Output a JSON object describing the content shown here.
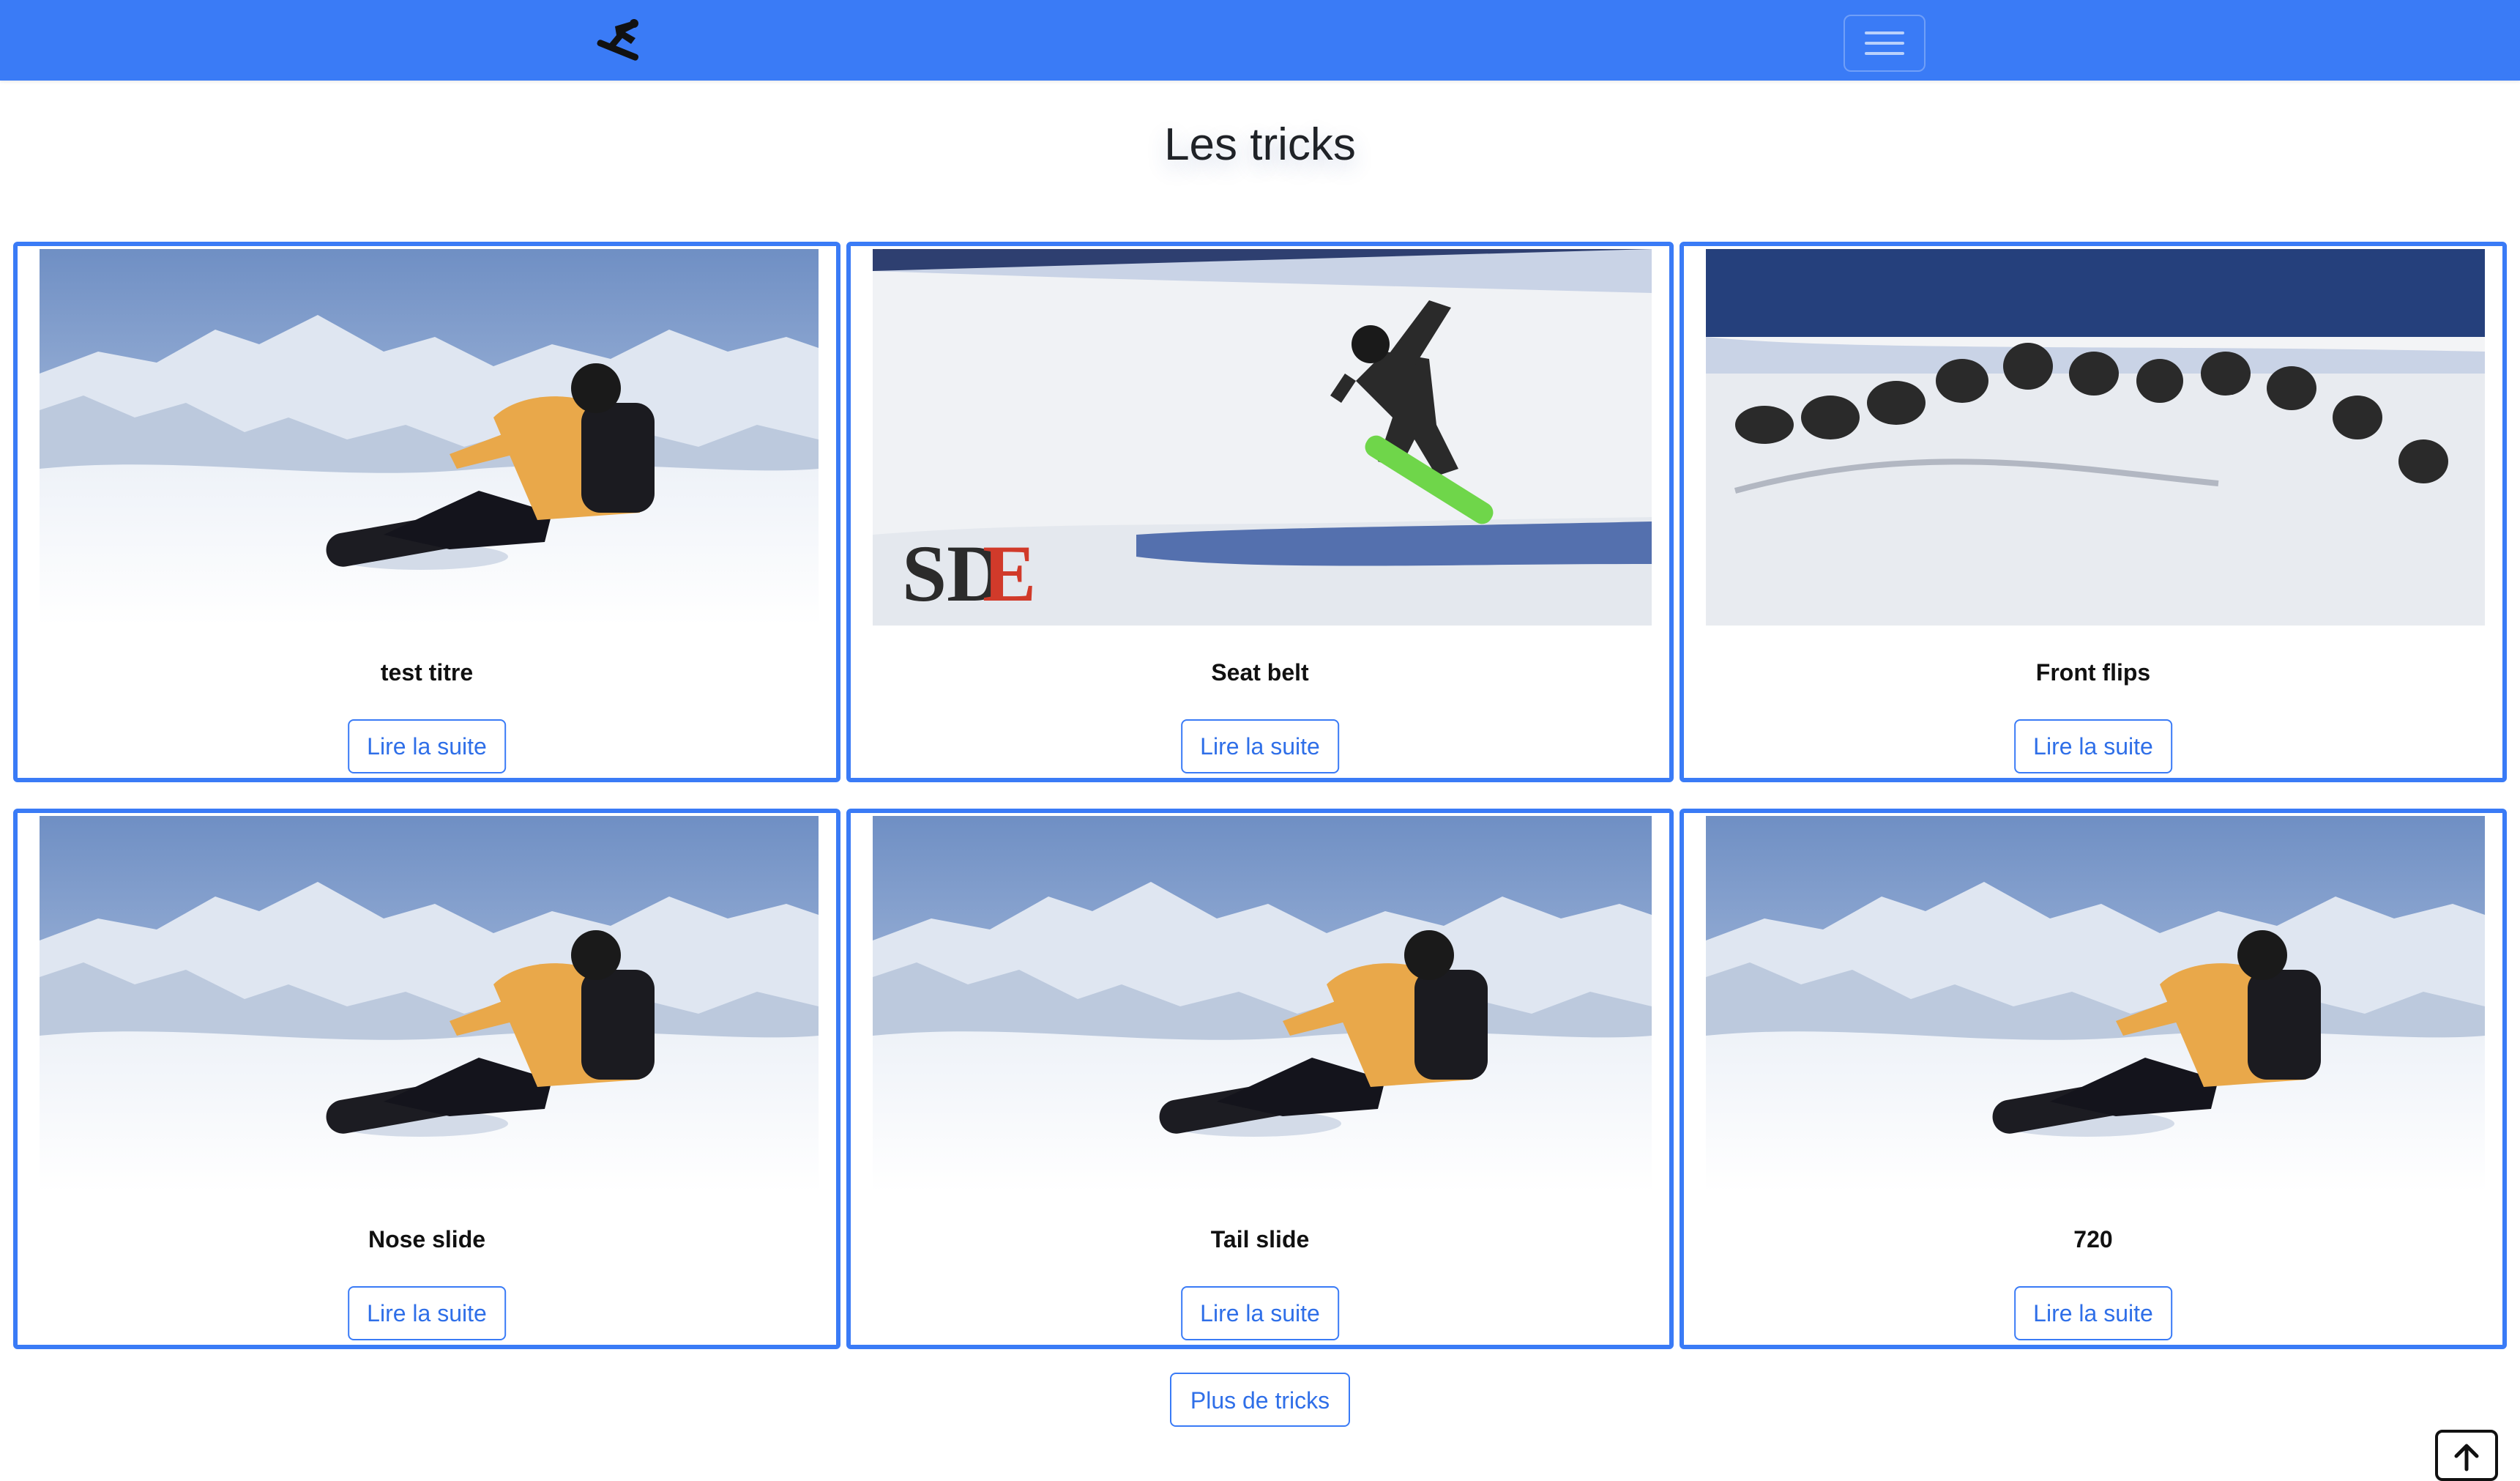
{
  "navbar": {
    "logo_icon": "snowboarder-logo-icon",
    "menu_icon": "hamburger-menu-icon",
    "colors": {
      "background": "#3a7bf6"
    }
  },
  "page": {
    "title": "Les tricks"
  },
  "tricks": [
    {
      "title": "test titre",
      "image": "seated-snowboarder-photo",
      "button": "Lire la suite"
    },
    {
      "title": "Seat belt",
      "image": "jumping-snowboarder-photo",
      "button": "Lire la suite"
    },
    {
      "title": "Front flips",
      "image": "front-flip-sequence-photo",
      "button": "Lire la suite"
    },
    {
      "title": "Nose slide",
      "image": "seated-snowboarder-photo",
      "button": "Lire la suite"
    },
    {
      "title": "Tail slide",
      "image": "seated-snowboarder-photo",
      "button": "Lire la suite"
    },
    {
      "title": "720",
      "image": "seated-snowboarder-photo",
      "button": "Lire la suite"
    }
  ],
  "more_button": "Plus de tricks",
  "scroll_top_icon": "arrow-up-icon",
  "accent_color": "#3a7bf6"
}
